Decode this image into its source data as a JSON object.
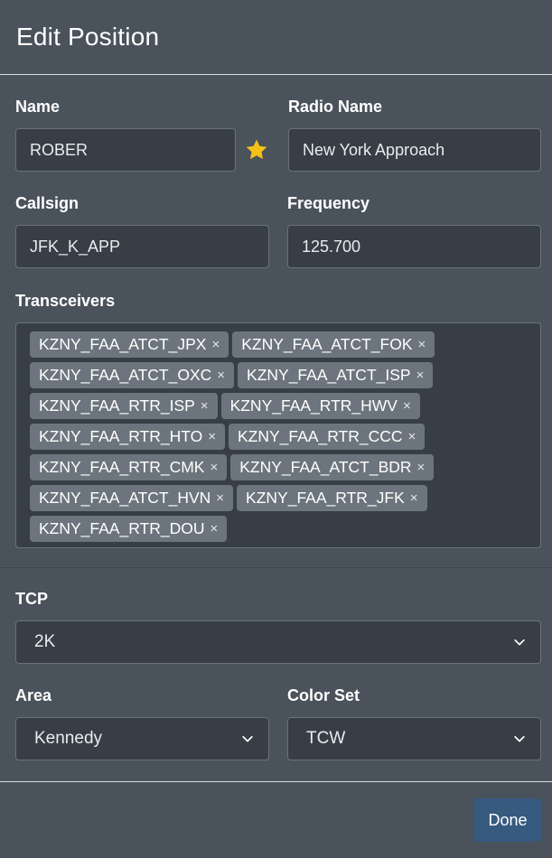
{
  "dialog": {
    "title": "Edit Position"
  },
  "fields": {
    "name": {
      "label": "Name",
      "value": "ROBER",
      "favorite_icon": "star-icon",
      "favorite_color": "#f5c116"
    },
    "radio_name": {
      "label": "Radio Name",
      "value": "New York Approach"
    },
    "callsign": {
      "label": "Callsign",
      "value": "JFK_K_APP"
    },
    "frequency": {
      "label": "Frequency",
      "value": "125.700"
    },
    "transceivers": {
      "label": "Transceivers",
      "remove_glyph": "×",
      "items": [
        "KZNY_FAA_ATCT_JPX",
        "KZNY_FAA_ATCT_FOK",
        "KZNY_FAA_ATCT_OXC",
        "KZNY_FAA_ATCT_ISP",
        "KZNY_FAA_RTR_ISP",
        "KZNY_FAA_RTR_HWV",
        "KZNY_FAA_RTR_HTO",
        "KZNY_FAA_RTR_CCC",
        "KZNY_FAA_RTR_CMK",
        "KZNY_FAA_ATCT_BDR",
        "KZNY_FAA_ATCT_HVN",
        "KZNY_FAA_RTR_JFK",
        "KZNY_FAA_RTR_DOU"
      ]
    },
    "tcp": {
      "label": "TCP",
      "selected": "2K"
    },
    "area": {
      "label": "Area",
      "selected": "Kennedy"
    },
    "color_set": {
      "label": "Color Set",
      "selected": "TCW"
    }
  },
  "footer": {
    "done_label": "Done"
  },
  "colors": {
    "accent": "#375a7f",
    "background": "#4a525b",
    "input_bg": "#373e45",
    "tag_bg": "#6c757d"
  }
}
